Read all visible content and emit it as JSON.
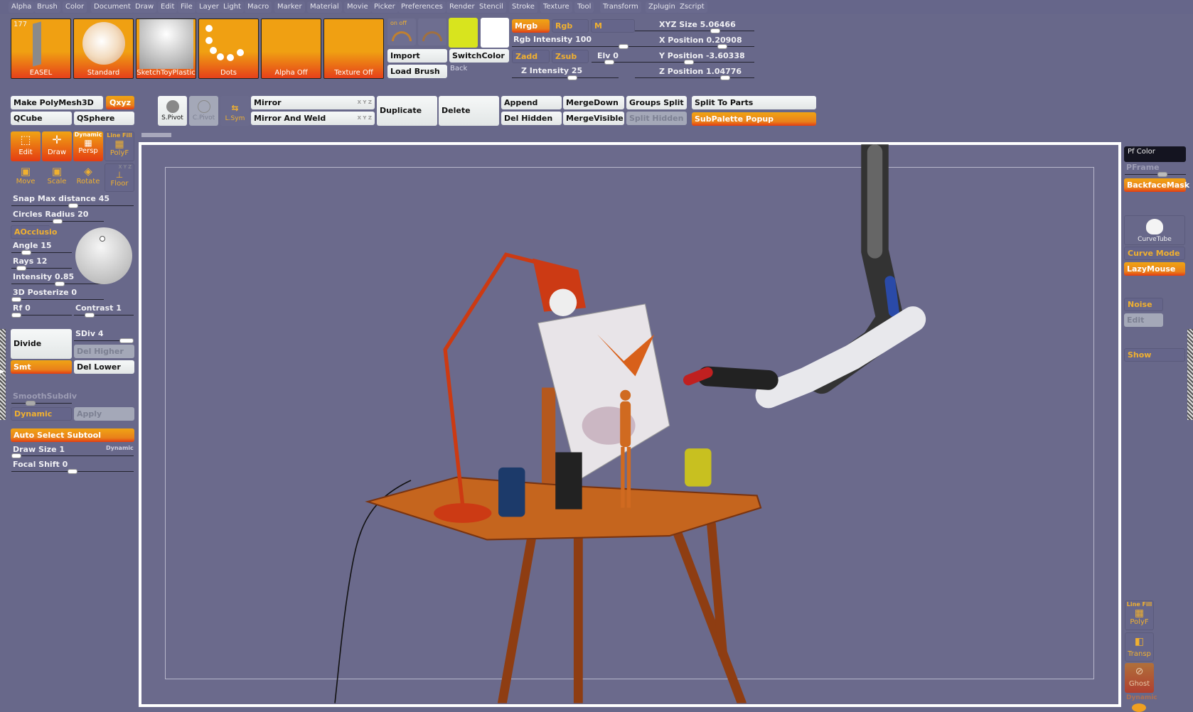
{
  "menu": [
    "Alpha",
    "Brush",
    "Color",
    "Document",
    "Draw",
    "Edit",
    "File",
    "Layer",
    "Light",
    "Macro",
    "Marker",
    "Material",
    "Movie",
    "Picker",
    "Preferences",
    "Render",
    "Stencil",
    "Stroke",
    "Texture",
    "Tool",
    "Transform",
    "Zplugin",
    "Zscript"
  ],
  "thumbs": {
    "count": "177",
    "tool": "EASEL",
    "brush": "Standard",
    "material": "SketchToyPlastic",
    "stroke": "Dots",
    "alpha": "Alpha Off",
    "texture": "Texture Off"
  },
  "top": {
    "onoff": "on off",
    "import": "Import",
    "load_brush": "Load Brush",
    "switch_color": "SwitchColor",
    "back": "Back",
    "mrgb": "Mrgb",
    "rgb": "Rgb",
    "m": "M",
    "rgb_intensity": "Rgb Intensity 100",
    "zadd": "Zadd",
    "zsub": "Zsub",
    "elv": "Elv 0",
    "z_intensity": "Z Intensity 25",
    "xyz_size": "XYZ Size 5.06466",
    "x_pos": "X Position 0.20908",
    "y_pos": "Y Position -3.60338",
    "z_pos": "Z Position 1.04776",
    "primary_color": "#d8e41e",
    "secondary_color": "#ffffff"
  },
  "row2": {
    "make_polymesh": "Make PolyMesh3D",
    "qxyz": "Qxyz",
    "qcube": "QCube",
    "qsphere": "QSphere",
    "spivot": "S.Pivot",
    "cpivot": "C.Pivot",
    "lsym": "L.Sym",
    "mirror": "Mirror",
    "mirror_weld": "Mirror And Weld",
    "xyz": "X Y Z",
    "duplicate": "Duplicate",
    "delete": "Delete",
    "append": "Append",
    "del_hidden": "Del Hidden",
    "merge_down": "MergeDown",
    "merge_visible": "MergeVisible",
    "groups_split": "Groups Split",
    "split_hidden": "Split Hidden",
    "split_parts": "Split To Parts",
    "subpalette": "SubPalette Popup"
  },
  "left": {
    "edit": "Edit",
    "draw": "Draw",
    "persp": "Persp",
    "dynamic": "Dynamic",
    "linefill": "Line Fill",
    "polyf": "PolyF",
    "move": "Move",
    "scale": "Scale",
    "rotate": "Rotate",
    "floor": "Floor",
    "xyz": "X Y Z",
    "snap": "Snap Max distance 45",
    "circles": "Circles Radius 20",
    "aocclusion": "AOcclusio",
    "angle": "Angle 15",
    "rays": "Rays 12",
    "intensity": "Intensity 0.85",
    "posterize": "3D Posterize 0",
    "rf": "Rf 0",
    "contrast": "Contrast 1",
    "divide": "Divide",
    "sdiv": "SDiv 4",
    "del_higher": "Del Higher",
    "smt": "Smt",
    "del_lower": "Del Lower",
    "smooth_subdiv": "SmoothSubdiv",
    "dynamic_btn": "Dynamic",
    "apply": "Apply",
    "auto_select": "Auto Select Subtool",
    "draw_size": "Draw Size 1",
    "draw_dynamic": "Dynamic",
    "focal_shift": "Focal Shift 0"
  },
  "right": {
    "pf_color": "Pf Color",
    "pframe": "PFrame",
    "backface": "BackfaceMask",
    "curvetube": "CurveTube",
    "curve_mode": "Curve Mode",
    "lazymouse": "LazyMouse",
    "noise": "Noise",
    "edit": "Edit",
    "show": "Show",
    "linefill": "Line Fill",
    "polyf": "PolyF",
    "transp": "Transp",
    "ghost": "Ghost",
    "dynamic": "Dynamic"
  },
  "colors": {
    "accent": "#ec8a14",
    "background": "#68688a",
    "viewport": "#6b6a8c"
  }
}
